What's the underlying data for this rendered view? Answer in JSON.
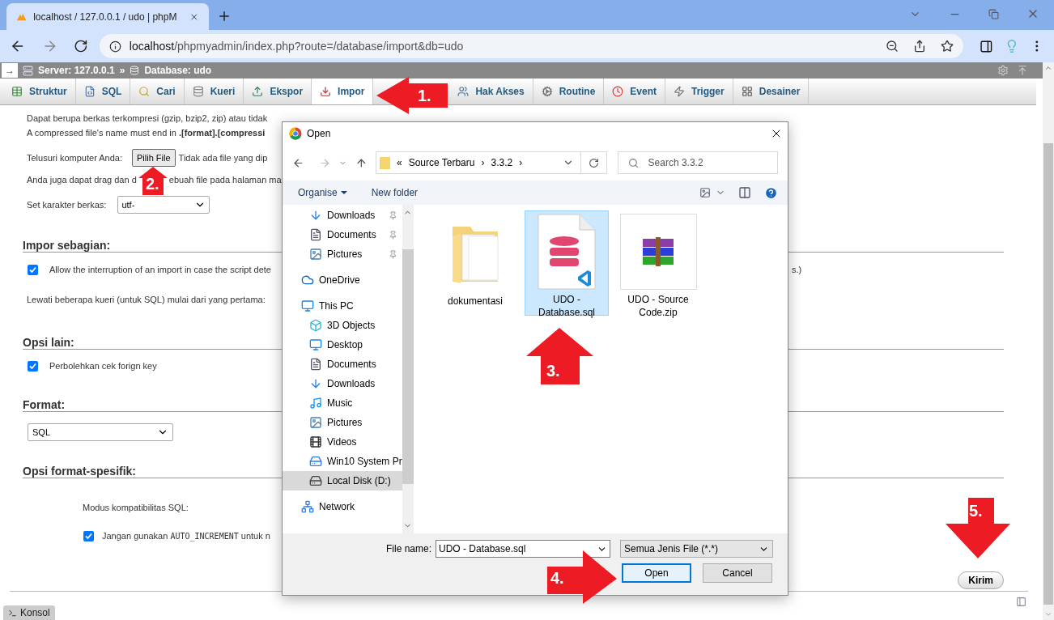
{
  "browser": {
    "tab_title": "localhost / 127.0.0.1 / udo | phpM",
    "url_host": "localhost",
    "url_path": "/phpmyadmin/index.php?route=/database/import&db=udo"
  },
  "breadcrumb": {
    "toggle": "→",
    "server": "Server: 127.0.0.1",
    "separator": "»",
    "database": "Database: udo"
  },
  "tabs": [
    {
      "kind": "tab",
      "label": "Struktur",
      "selected": false
    },
    {
      "kind": "tab",
      "label": "SQL",
      "selected": false
    },
    {
      "kind": "tab",
      "label": "Cari",
      "selected": false
    },
    {
      "kind": "tab",
      "label": "Kueri",
      "selected": false
    },
    {
      "kind": "tab",
      "label": "Ekspor",
      "selected": false
    },
    {
      "kind": "tab",
      "label": "Impor",
      "selected": true
    },
    {
      "kind": "covered"
    },
    {
      "kind": "tab",
      "label": "Hak Akses",
      "selected": false
    },
    {
      "kind": "tab",
      "label": "Routine",
      "selected": false
    },
    {
      "kind": "tab",
      "label": "Event",
      "selected": false
    },
    {
      "kind": "tab",
      "label": "Trigger",
      "selected": false
    },
    {
      "kind": "tab",
      "label": "Desainer",
      "selected": false
    }
  ],
  "file_section": {
    "intro": "Dapat berupa berkas terkompresi (gzip, bzip2, zip) atau tidak",
    "compressed_note": "A compressed file's name must end in **.[format].[compressi**",
    "browse_label": "Telusuri komputer Anda:",
    "browse_button": "Pilih File",
    "no_file": "Tidak ada file yang dip",
    "drag_before": "Anda juga dapat drag dan d",
    "drag_after": "ebuah file pada halaman ma",
    "charset_label": "Set karakter berkas:",
    "charset_value": "utf-"
  },
  "partial": {
    "heading": "Impor sebagian:",
    "allow_interrupt": {
      "label": "Allow the interruption of an import in case the script dete",
      "checked": true
    },
    "allow_tail": "s.)",
    "skip_label": "Lewati beberapa kueri (untuk SQL) mulai dari yang pertama:"
  },
  "other": {
    "heading": "Opsi lain:",
    "foreign_key": {
      "label": "Perbolehkan cek forign key",
      "checked": true
    }
  },
  "format": {
    "heading": "Format:",
    "value": "SQL"
  },
  "format_specific": {
    "heading": "Opsi format-spesifik:",
    "compat_label": "Modus kompatibilitas SQL:",
    "no_auto_increment": {
      "before": "Jangan gunakan",
      "code": "AUTO_INCREMENT",
      "after": "untuk n",
      "checked": true
    }
  },
  "submit": "Kirim",
  "console": "Konsol",
  "dialog": {
    "title": "Open",
    "path": [
      {
        "label": "«"
      },
      {
        "label": "Source Terbaru"
      },
      {
        "label": "›"
      },
      {
        "label": "3.3.2"
      },
      {
        "label": "›"
      }
    ],
    "search_placeholder": "Search 3.3.2",
    "organise": "Organise",
    "new_folder": "New folder",
    "quick_access": [
      {
        "label": "Downloads",
        "selected": false
      },
      {
        "label": "Documents",
        "selected": false
      },
      {
        "label": "Pictures",
        "selected": false
      }
    ],
    "nav": [
      {
        "label": "OneDrive",
        "selected": false
      },
      {
        "label": "This PC",
        "selected": false,
        "children": [
          {
            "label": "3D Objects",
            "selected": false
          },
          {
            "label": "Desktop",
            "selected": false
          },
          {
            "label": "Documents",
            "selected": false
          },
          {
            "label": "Downloads",
            "selected": false
          },
          {
            "label": "Music",
            "selected": false
          },
          {
            "label": "Pictures",
            "selected": false
          },
          {
            "label": "Videos",
            "selected": false
          },
          {
            "label": "Win10 System Pr",
            "selected": false
          },
          {
            "label": "Local Disk (D:)",
            "selected": true
          }
        ]
      },
      {
        "label": "Network",
        "selected": false
      }
    ],
    "files": [
      {
        "name": "dokumentasi",
        "selected": false
      },
      {
        "name": "UDO - Database.sql",
        "selected": true
      },
      {
        "name": "UDO - Source Code.zip",
        "selected": false
      }
    ],
    "file_name_label": "File name:",
    "file_name": "UDO - Database.sql",
    "file_type": "Semua Jenis File (*.*)",
    "open": "Open",
    "cancel": "Cancel"
  },
  "annotations": [
    {
      "label": "1."
    },
    {
      "label": "2."
    },
    {
      "label": "3."
    },
    {
      "label": "4."
    },
    {
      "label": "5."
    }
  ]
}
